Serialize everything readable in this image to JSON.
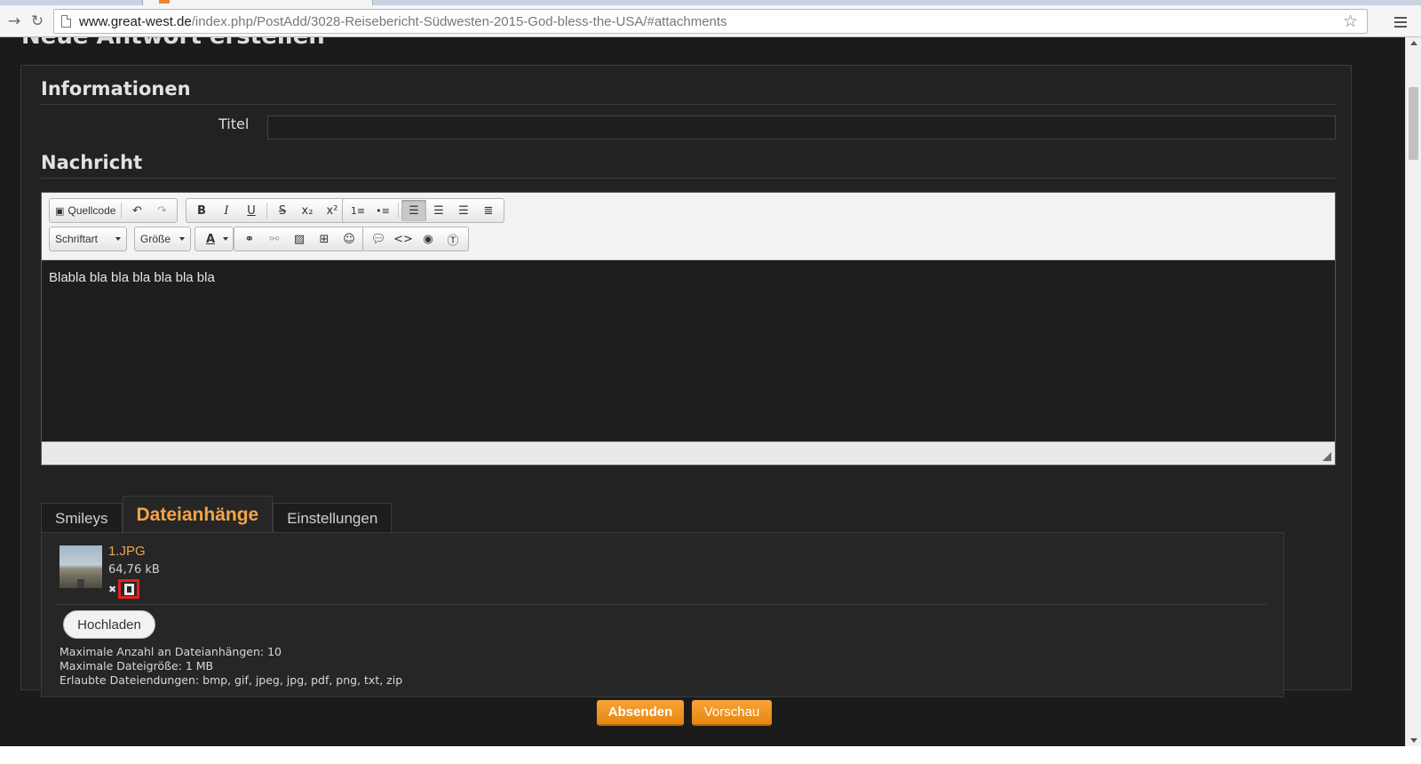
{
  "browser": {
    "url_host": "www.great-west.de",
    "url_path": "/index.php/PostAdd/3028-Reisebericht-Südwesten-2015-God-bless-the-USA/#attachments"
  },
  "page": {
    "heading": "Neue Antwort erstellen"
  },
  "info_section": {
    "title": "Informationen",
    "title_label": "Titel",
    "title_value": ""
  },
  "message_section": {
    "title": "Nachricht",
    "toolbar": {
      "source_label": "Quellcode",
      "font_label": "Schriftart",
      "size_label": "Größe"
    },
    "body_text": "Blabla bla bla bla bla bla bla"
  },
  "tabs": [
    {
      "label": "Smileys",
      "active": false
    },
    {
      "label": "Dateianhänge",
      "active": true
    },
    {
      "label": "Einstellungen",
      "active": false
    }
  ],
  "attachment": {
    "file_name": "1.JPG",
    "file_size": "64,76 kB"
  },
  "upload_label": "Hochladen",
  "limits": [
    "Maximale Anzahl an Dateianhängen: 10",
    "Maximale Dateigröße: 1 MB",
    "Erlaubte Dateiendungen: bmp, gif, jpeg, jpg, pdf, png, txt, zip"
  ],
  "actions": {
    "submit_label": "Absenden",
    "preview_label": "Vorschau"
  },
  "colors": {
    "accent": "#f3a44a",
    "button": "#f0961f",
    "highlight_box": "#e02020"
  }
}
